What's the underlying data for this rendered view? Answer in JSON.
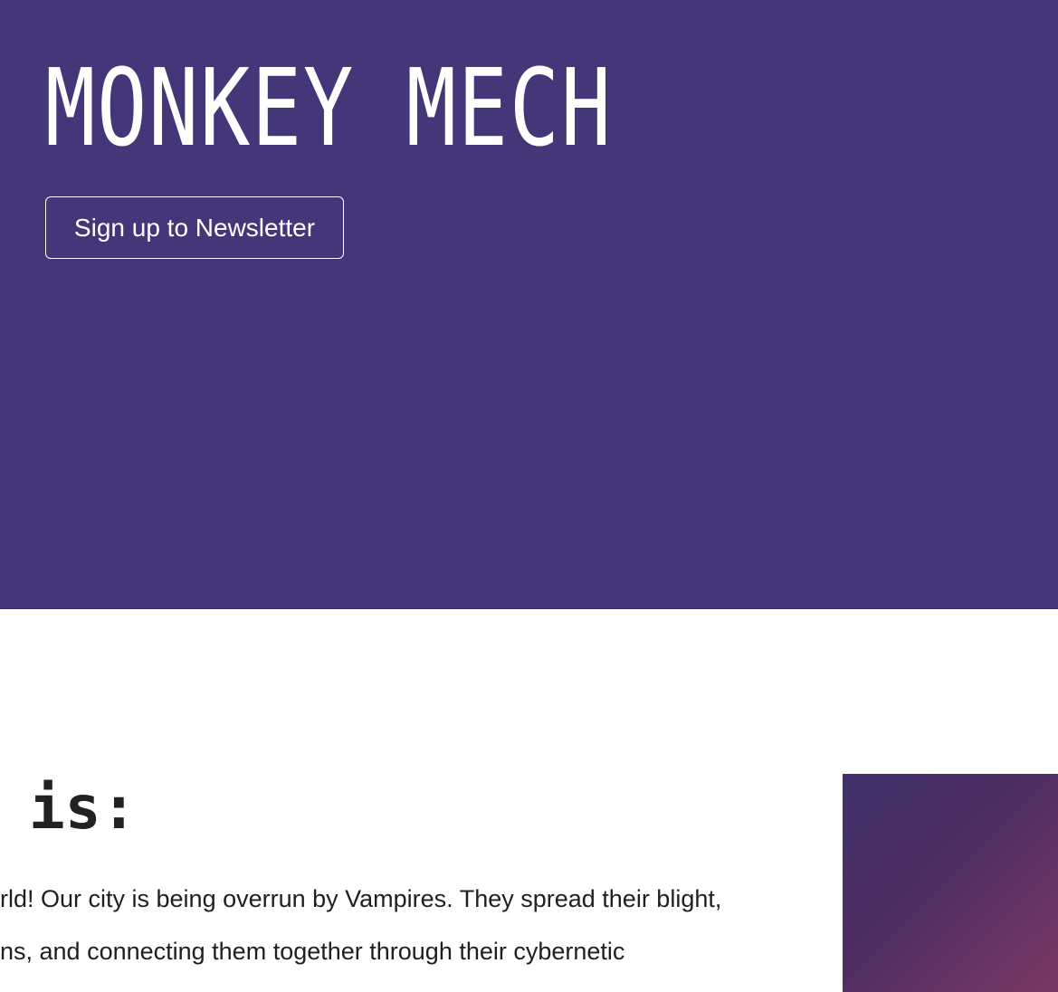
{
  "hero": {
    "title": "MONKEY MECH",
    "newsletter_button": "Sign up to Newsletter"
  },
  "about": {
    "heading": "is:",
    "lines": [
      "rld! Our city is being overrun by Vampires. They spread their blight,",
      "ns, and connecting them together through their cybernetic"
    ]
  },
  "colors": {
    "hero_background": "#45367a",
    "hero_text": "#ffffff",
    "body_text": "#1f1f1f"
  }
}
